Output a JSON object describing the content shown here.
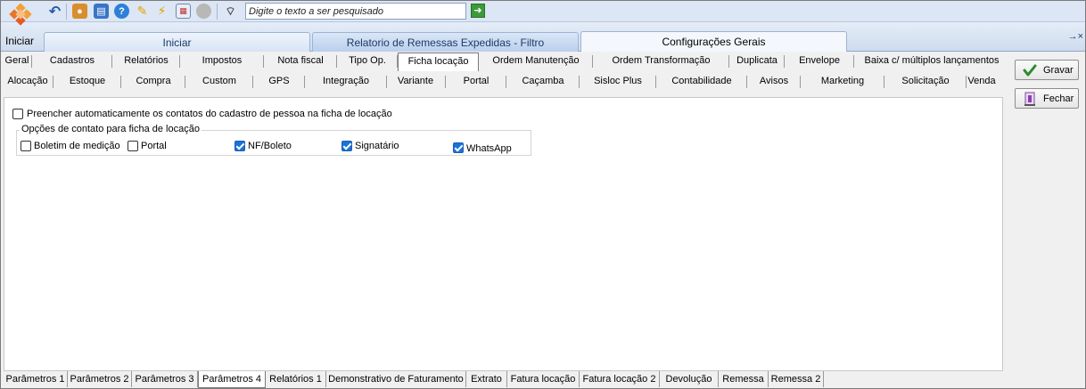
{
  "toolbar": {
    "start_label": "Iniciar",
    "search_placeholder": "Digite o texto a ser pesquisado",
    "go_icon": "arrow-right-icon"
  },
  "ribbon_tabs": [
    {
      "label": "Iniciar"
    },
    {
      "label": "Relatorio de Remessas Expedidas - Filtro"
    },
    {
      "label": "Configurações Gerais"
    }
  ],
  "tabs_row1": [
    "Geral",
    "Cadastros",
    "Relatórios",
    "Impostos",
    "Nota fiscal",
    "Tipo Op.",
    "Ficha locação",
    "Ordem Manutenção",
    "Ordem Transformação",
    "Duplicata",
    "Envelope",
    "Baixa c/ múltiplos lançamentos"
  ],
  "tabs_row2": [
    "Alocação",
    "Estoque",
    "Compra",
    "Custom",
    "GPS",
    "Integração",
    "Variante",
    "Portal",
    "Caçamba",
    "Sisloc Plus",
    "Contabilidade",
    "Avisos",
    "Marketing",
    "Solicitação",
    "Venda"
  ],
  "active_subtab": "Ficha locação",
  "form": {
    "auto_fill_label": "Preencher automaticamente os contatos do cadastro de pessoa na ficha de locação",
    "auto_fill_checked": false,
    "group_title": "Opções de contato para ficha de locação",
    "options": [
      {
        "label": "Boletim de medição",
        "checked": false
      },
      {
        "label": "Portal",
        "checked": false
      },
      {
        "label": "NF/Boleto",
        "checked": true
      },
      {
        "label": "Signatário",
        "checked": true
      },
      {
        "label": "WhatsApp",
        "checked": true
      }
    ]
  },
  "actions": {
    "save_label": "Gravar",
    "close_label": "Fechar"
  },
  "bottom_tabs": [
    "Parâmetros 1",
    "Parâmetros 2",
    "Parâmetros 3",
    "Parâmetros 4",
    "Relatórios 1",
    "Demonstrativo de Faturamento",
    "Extrato",
    "Fatura locação",
    "Fatura locação 2",
    "Devolução",
    "Remessa",
    "Remessa 2"
  ],
  "active_bottom_tab": "Parâmetros 4"
}
